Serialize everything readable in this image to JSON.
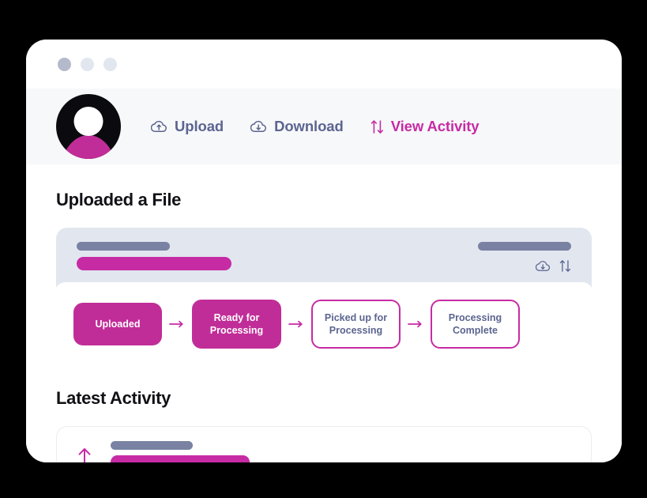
{
  "window": {
    "traffic_lights": [
      "window-dot-1",
      "window-dot-2",
      "window-dot-3"
    ]
  },
  "nav": {
    "avatar_label": "user-avatar",
    "links": [
      {
        "label": "Upload",
        "icon": "cloud-upload-icon",
        "active": false
      },
      {
        "label": "Download",
        "icon": "cloud-download-icon",
        "active": false
      },
      {
        "label": "View Activity",
        "icon": "sort-arrows-icon",
        "active": true
      }
    ]
  },
  "uploaded_file": {
    "title": "Uploaded a File",
    "header_icons": [
      "cloud-download-icon",
      "sort-arrows-icon"
    ],
    "steps": [
      {
        "label": "Uploaded",
        "state": "filled"
      },
      {
        "label": "Ready for Processing",
        "state": "filled"
      },
      {
        "label": "Picked up for Processing",
        "state": "outlined"
      },
      {
        "label": "Processing Complete",
        "state": "outlined"
      }
    ]
  },
  "latest_activity": {
    "title": "Latest Activity",
    "row_icon": "arrow-up-icon"
  },
  "colors": {
    "accent": "#c62ba4",
    "accent_fill": "#c12d98",
    "slate": "#5c6590",
    "skeleton_grey": "#7a82a3",
    "card_grey": "#e2e6ef",
    "nav_bg": "#f7f8fa"
  }
}
